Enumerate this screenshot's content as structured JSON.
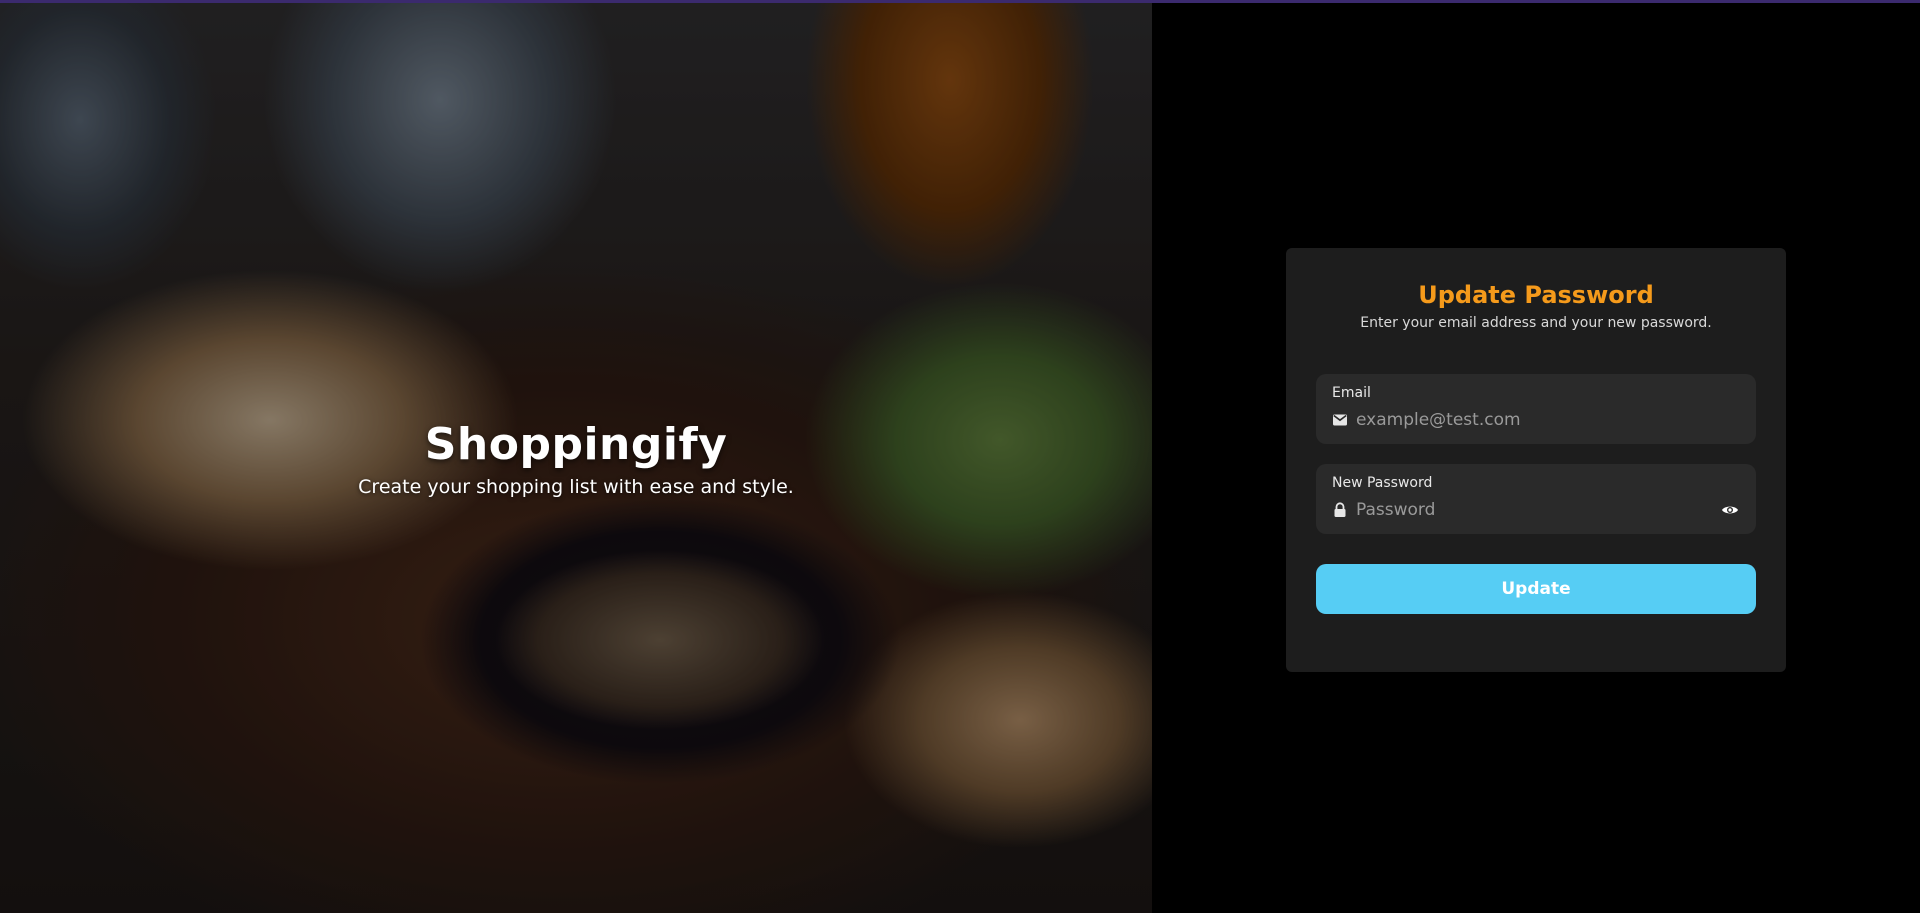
{
  "hero": {
    "title": "Shoppingify",
    "subtitle": "Create your shopping list with ease and style."
  },
  "form": {
    "title": "Update Password",
    "subtitle": "Enter your email address and your new password.",
    "email": {
      "label": "Email",
      "placeholder": "example@test.com",
      "value": "",
      "icon": "mail-icon"
    },
    "password": {
      "label": "New Password",
      "placeholder": "Password",
      "value": "",
      "icon": "lock-icon",
      "toggle_icon": "eye-icon"
    },
    "submit_label": "Update"
  },
  "colors": {
    "accent_title": "#f59a1b",
    "button": "#56cdf4",
    "card_bg": "#1d1d1d",
    "field_bg": "#2a2a2a"
  }
}
